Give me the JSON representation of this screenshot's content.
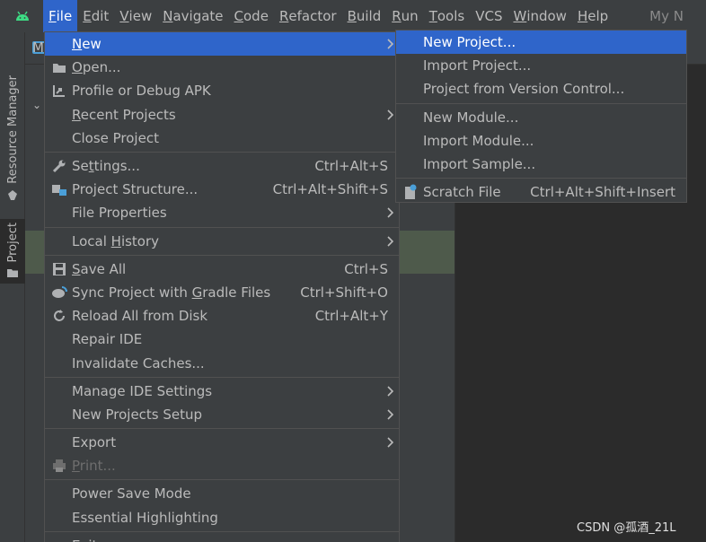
{
  "menubar": {
    "items": [
      {
        "label": "File",
        "mn": "F",
        "rest": "ile"
      },
      {
        "label": "Edit",
        "mn": "E",
        "rest": "dit"
      },
      {
        "label": "View",
        "mn": "V",
        "rest": "iew"
      },
      {
        "label": "Navigate",
        "mn": "N",
        "rest": "avigate"
      },
      {
        "label": "Code",
        "mn": "C",
        "rest": "ode"
      },
      {
        "label": "Refactor",
        "mn": "R",
        "rest": "efactor"
      },
      {
        "label": "Build",
        "mn": "B",
        "rest": "uild"
      },
      {
        "label": "Run",
        "mn": "R",
        "rest": "un",
        "pre": ""
      },
      {
        "label": "Tools",
        "mn": "T",
        "rest": "ools"
      },
      {
        "label": "VCS",
        "mn": "",
        "rest": "VCS"
      },
      {
        "label": "Window",
        "mn": "W",
        "rest": "indow"
      },
      {
        "label": "Help",
        "mn": "H",
        "rest": "elp"
      }
    ],
    "project_name": "My N"
  },
  "breadcrumb": {
    "text": "M"
  },
  "toolstrip": {
    "resource_manager": "Resource Manager",
    "project": "Project"
  },
  "file_menu": {
    "items": [
      {
        "label": "New",
        "submenu": true,
        "highlighted": true
      },
      {
        "label": "Open...",
        "icon": "folder-icon"
      },
      {
        "label": "Profile or Debug APK",
        "icon": "profile-apk-icon"
      },
      {
        "label": "Recent Projects",
        "submenu": true
      },
      {
        "label": "Close Project"
      },
      {
        "sep": true
      },
      {
        "label": "Settings...",
        "shortcut": "Ctrl+Alt+S",
        "icon": "wrench-icon"
      },
      {
        "label": "Project Structure...",
        "shortcut": "Ctrl+Alt+Shift+S",
        "icon": "project-structure-icon"
      },
      {
        "label": "File Properties",
        "submenu": true
      },
      {
        "sep": true
      },
      {
        "label": "Local History",
        "submenu": true
      },
      {
        "sep": true
      },
      {
        "label": "Save All",
        "shortcut": "Ctrl+S",
        "icon": "save-icon"
      },
      {
        "label": "Sync Project with Gradle Files",
        "shortcut": "Ctrl+Shift+O",
        "icon": "gradle-sync-icon"
      },
      {
        "label": "Reload All from Disk",
        "shortcut": "Ctrl+Alt+Y",
        "icon": "reload-icon"
      },
      {
        "label": "Repair IDE"
      },
      {
        "label": "Invalidate Caches..."
      },
      {
        "sep": true
      },
      {
        "label": "Manage IDE Settings",
        "submenu": true
      },
      {
        "label": "New Projects Setup",
        "submenu": true
      },
      {
        "sep": true
      },
      {
        "label": "Export",
        "submenu": true
      },
      {
        "label": "Print...",
        "disabled": true,
        "icon": "print-icon"
      },
      {
        "sep": true
      },
      {
        "label": "Power Save Mode"
      },
      {
        "label": "Essential Highlighting"
      },
      {
        "sep": true
      },
      {
        "label": "Exit"
      }
    ]
  },
  "new_menu": {
    "items": [
      {
        "label": "New Project...",
        "highlighted": true
      },
      {
        "label": "Import Project..."
      },
      {
        "label": "Project from Version Control..."
      },
      {
        "sep": true
      },
      {
        "label": "New Module..."
      },
      {
        "label": "Import Module..."
      },
      {
        "label": "Import Sample..."
      },
      {
        "sep": true
      },
      {
        "label": "Scratch File",
        "shortcut": "Ctrl+Alt+Shift+Insert",
        "icon": "scratch-file-icon"
      }
    ]
  },
  "watermark": "CSDN @孤酒_21L",
  "colors": {
    "accent": "#2f65ca",
    "menu_bg": "#3c3f41",
    "editor_bg": "#2b2b2b",
    "android_green": "#3ddc84"
  }
}
